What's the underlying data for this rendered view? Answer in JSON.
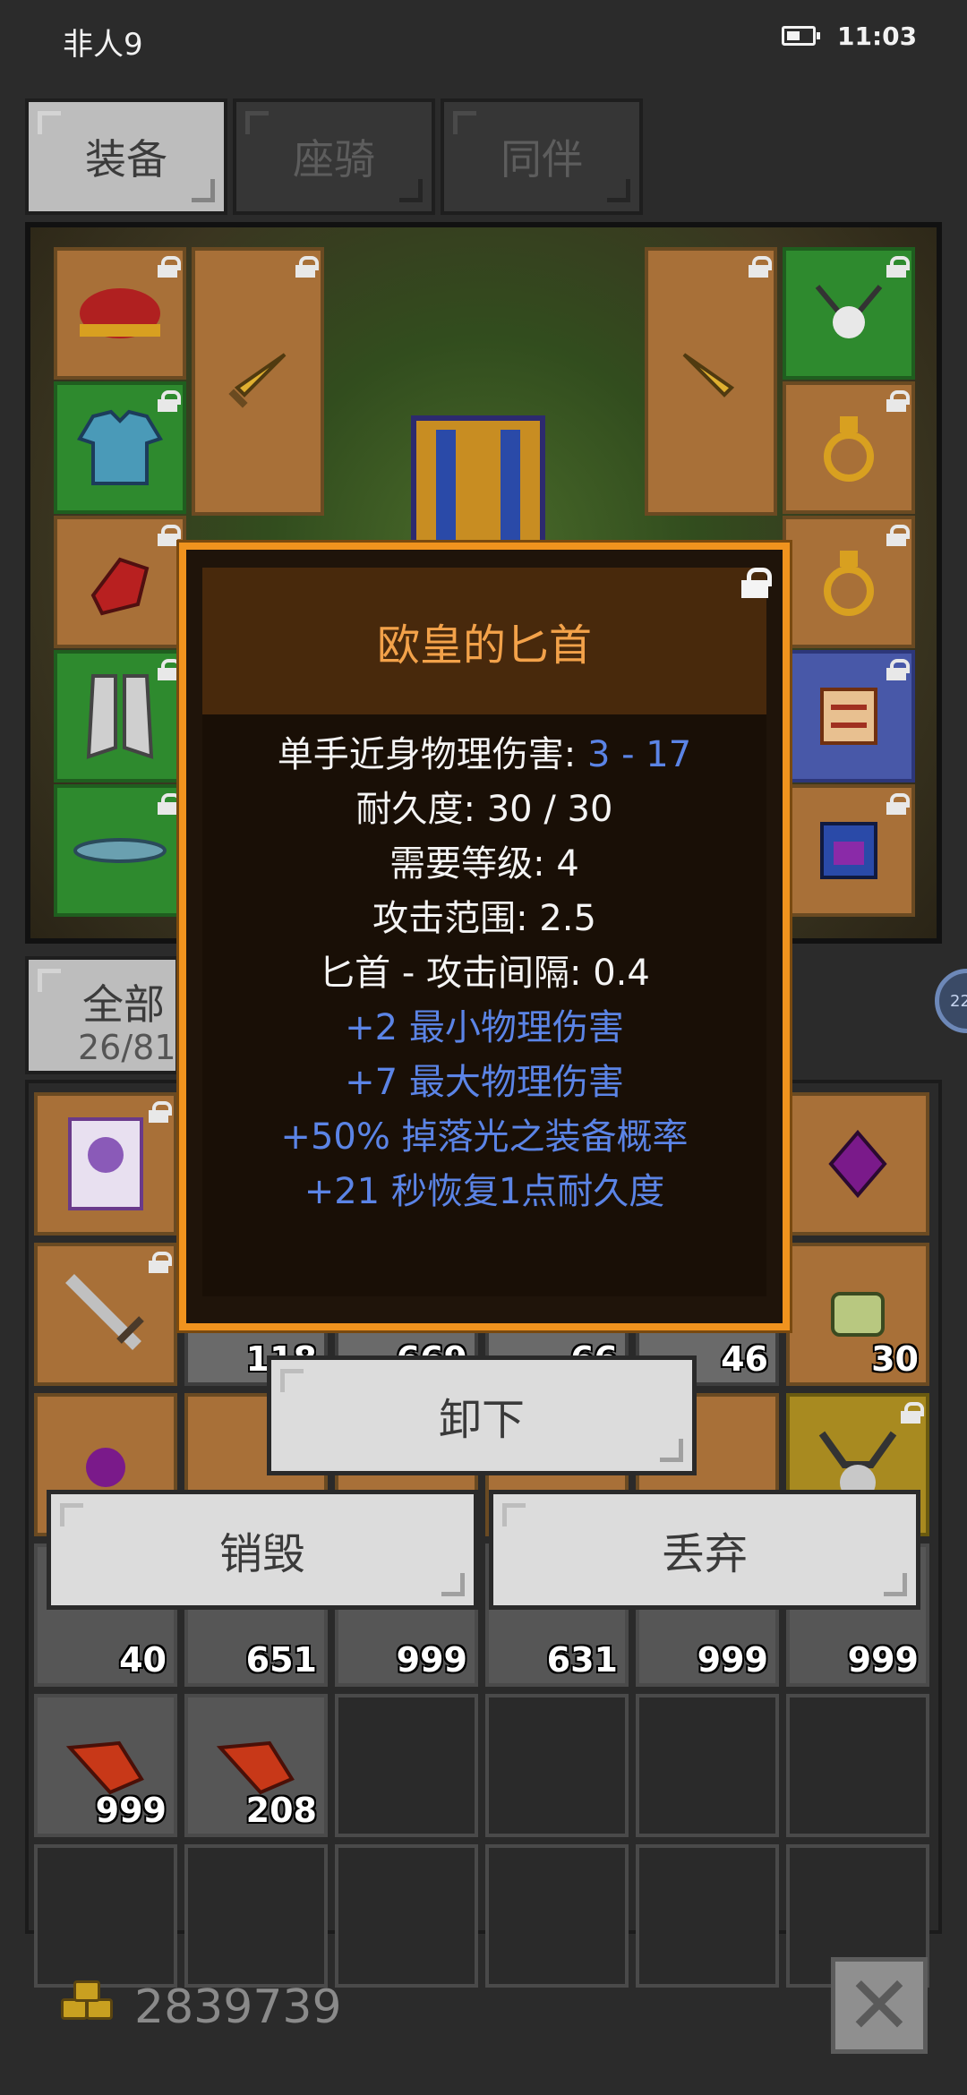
{
  "status_bar": {
    "carrier": "非人9",
    "time": "11:03"
  },
  "tabs": [
    {
      "label": "装备",
      "active": true
    },
    {
      "label": "座骑",
      "active": false
    },
    {
      "label": "同伴",
      "active": false
    }
  ],
  "filter": {
    "label": "全部",
    "count": "26/81"
  },
  "inventory_quantities": {
    "r2": [
      "118",
      "669",
      "66",
      "46",
      "30"
    ],
    "r4": [
      "40",
      "651",
      "999",
      "631",
      "999",
      "999"
    ],
    "r5": [
      "999",
      "208"
    ]
  },
  "side_bubble": {
    "text": "22"
  },
  "tooltip": {
    "title": "欧皇的匕首",
    "damage_label": "单手近身物理伤害: ",
    "damage_value": "3 - 17",
    "durability": "耐久度: 30 / 30",
    "level_req": "需要等级: 4",
    "range": "攻击范围: 2.5",
    "interval": "匕首 - 攻击间隔: 0.4",
    "bonus_1": "+2 最小物理伤害",
    "bonus_2": "+7 最大物理伤害",
    "bonus_3": "+50% 掉落光之装备概率",
    "bonus_4": "+21 秒恢复1点耐久度"
  },
  "actions": {
    "unequip": "卸下",
    "destroy": "销毁",
    "discard": "丢弃"
  },
  "gold": "2839739",
  "colors": {
    "tooltip_border": "#f0931e",
    "title": "#f3a24a",
    "stat_blue": "#5b84e6"
  }
}
